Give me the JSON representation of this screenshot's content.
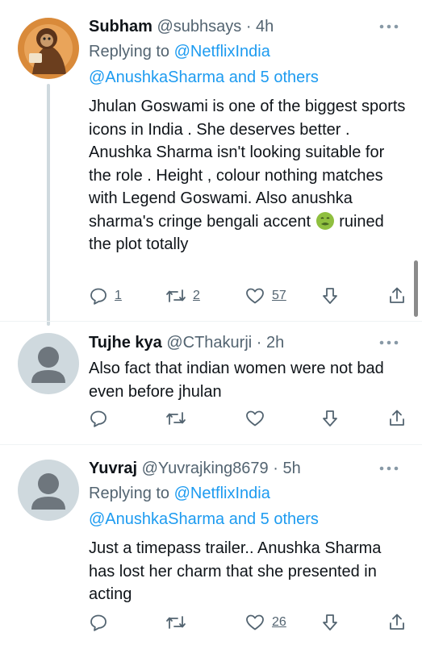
{
  "tweets": [
    {
      "name": "Subham",
      "handle": "@subhsays",
      "time": "· 4h",
      "replying_prefix": "Replying to ",
      "replying_user": "@NetflixIndia",
      "replying_second": "@AnushkaSharma",
      "replying_others": " and 5 others",
      "text_before_emoji": "Jhulan Goswami is one of the biggest sports icons in India . She deserves better . Anushka Sharma isn't looking suitable for the role . Height , colour nothing matches with Legend Goswami. Also anushka sharma's cringe bengali accent ",
      "emoji_icon": "nauseated-face",
      "text_after_emoji": " ruined the plot totally",
      "reply_count": "1",
      "retweet_count": "2",
      "like_count": "57"
    },
    {
      "name": "Tujhe kya",
      "handle": "@CThakurji",
      "time": "· 2h",
      "text": "Also fact that indian women were not bad even before jhulan",
      "reply_count": "",
      "retweet_count": "",
      "like_count": ""
    },
    {
      "name": "Yuvraj",
      "handle": "@Yuvrajking8679",
      "time": "· 5h",
      "replying_prefix": "Replying to ",
      "replying_user": "@NetflixIndia",
      "replying_second": "@AnushkaSharma",
      "replying_others": " and 5 others",
      "text": "Just a timepass trailer.. Anushka Sharma has lost her charm that she presented in acting",
      "reply_count": "",
      "retweet_count": "",
      "like_count": "26"
    }
  ],
  "icons": {
    "reply": "reply-icon",
    "retweet": "retweet-icon",
    "like": "heart-icon",
    "bookmark": "bookmark-icon",
    "share": "share-icon",
    "more": "more-icon"
  },
  "colors": {
    "link": "#1d9bf0",
    "secondary": "#536471",
    "text": "#0f1419",
    "thread_line": "#cfd9de"
  }
}
